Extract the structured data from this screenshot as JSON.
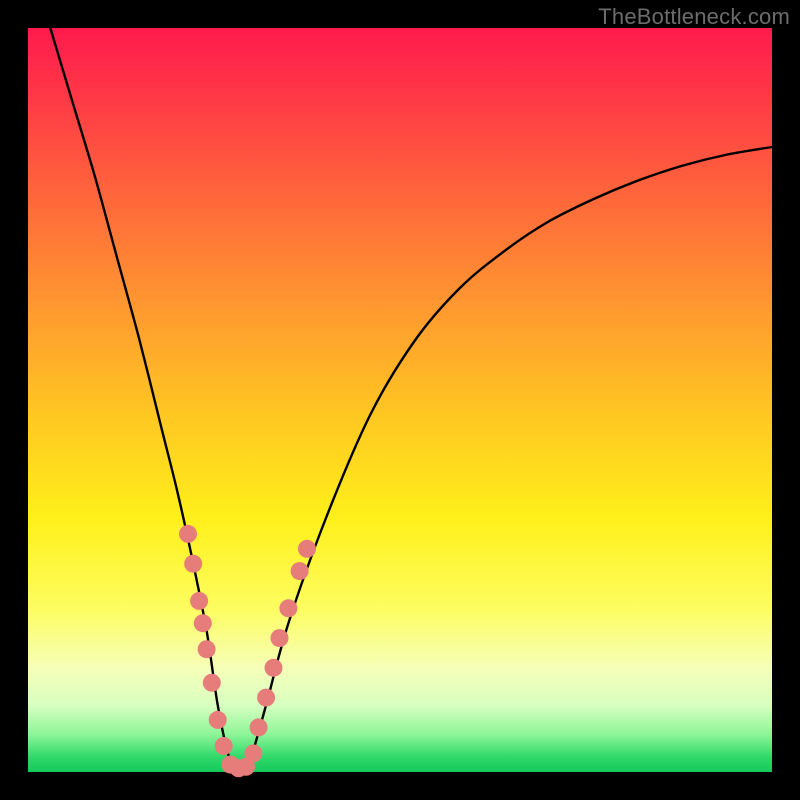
{
  "watermark": "TheBottleneck.com",
  "chart_data": {
    "type": "line",
    "title": "",
    "xlabel": "",
    "ylabel": "",
    "xlim": [
      0,
      100
    ],
    "ylim": [
      0,
      100
    ],
    "note": "No numeric axes or labels are shown; x and y are nominal 0–100 canvas percentages. Values are read from pixel positions.",
    "series": [
      {
        "name": "bottleneck-curve",
        "x": [
          3,
          6,
          9,
          12,
          15,
          18,
          20,
          22,
          24,
          25.5,
          27,
          28,
          29,
          30,
          32,
          35,
          40,
          46,
          52,
          58,
          64,
          70,
          76,
          82,
          88,
          94,
          100
        ],
        "y": [
          100,
          90,
          80,
          69,
          58,
          46,
          38,
          29,
          19,
          9,
          2,
          0,
          0,
          2,
          9,
          20,
          34,
          48,
          58,
          65,
          70,
          74,
          77,
          79.5,
          81.5,
          83,
          84
        ]
      }
    ],
    "markers": {
      "name": "highlight-dots",
      "color": "#e77d7a",
      "points": [
        {
          "x": 21.5,
          "y": 32
        },
        {
          "x": 22.2,
          "y": 28
        },
        {
          "x": 23.0,
          "y": 23
        },
        {
          "x": 23.5,
          "y": 20
        },
        {
          "x": 24.0,
          "y": 16.5
        },
        {
          "x": 24.7,
          "y": 12
        },
        {
          "x": 25.5,
          "y": 7
        },
        {
          "x": 26.3,
          "y": 3.5
        },
        {
          "x": 27.2,
          "y": 1
        },
        {
          "x": 28.3,
          "y": 0.5
        },
        {
          "x": 29.3,
          "y": 0.7
        },
        {
          "x": 30.3,
          "y": 2.5
        },
        {
          "x": 31.0,
          "y": 6
        },
        {
          "x": 32.0,
          "y": 10
        },
        {
          "x": 33.0,
          "y": 14
        },
        {
          "x": 33.8,
          "y": 18
        },
        {
          "x": 35.0,
          "y": 22
        },
        {
          "x": 36.5,
          "y": 27
        },
        {
          "x": 37.5,
          "y": 30
        }
      ]
    },
    "background_gradient": {
      "top": "#ff1a4d",
      "middle": "#fff01a",
      "bottom": "#14c95a"
    }
  }
}
